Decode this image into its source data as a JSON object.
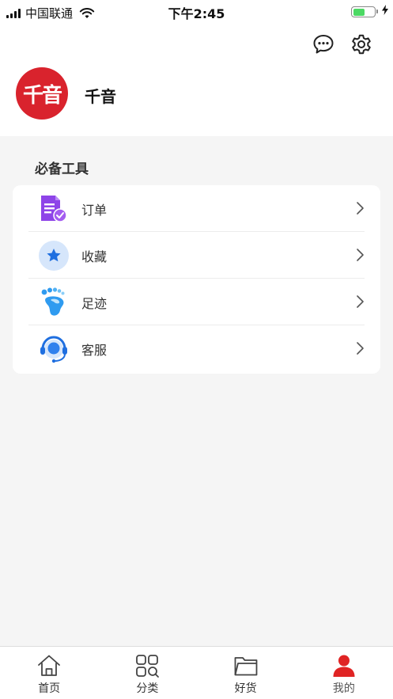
{
  "status_bar": {
    "carrier": "中国联通",
    "time": "下午2:45",
    "battery_level": 0.55
  },
  "header": {
    "icons": [
      "message-icon",
      "settings-icon"
    ]
  },
  "profile": {
    "avatar_text": "千音",
    "username": "千音",
    "avatar_color": "#d9232d"
  },
  "tools": {
    "title": "必备工具",
    "items": [
      {
        "label": "订单",
        "icon": "order-icon",
        "color": "#8e44e8"
      },
      {
        "label": "收藏",
        "icon": "star-icon",
        "color": "#2f80ed"
      },
      {
        "label": "足迹",
        "icon": "footprint-icon",
        "color": "#2f9bf0"
      },
      {
        "label": "客服",
        "icon": "headset-icon",
        "color": "#2f80ed"
      }
    ]
  },
  "tabbar": {
    "items": [
      {
        "label": "首页",
        "icon": "home-icon"
      },
      {
        "label": "分类",
        "icon": "category-icon"
      },
      {
        "label": "好货",
        "icon": "folder-icon"
      },
      {
        "label": "我的",
        "icon": "user-icon",
        "active": true
      }
    ],
    "active_color": "#e02424"
  }
}
